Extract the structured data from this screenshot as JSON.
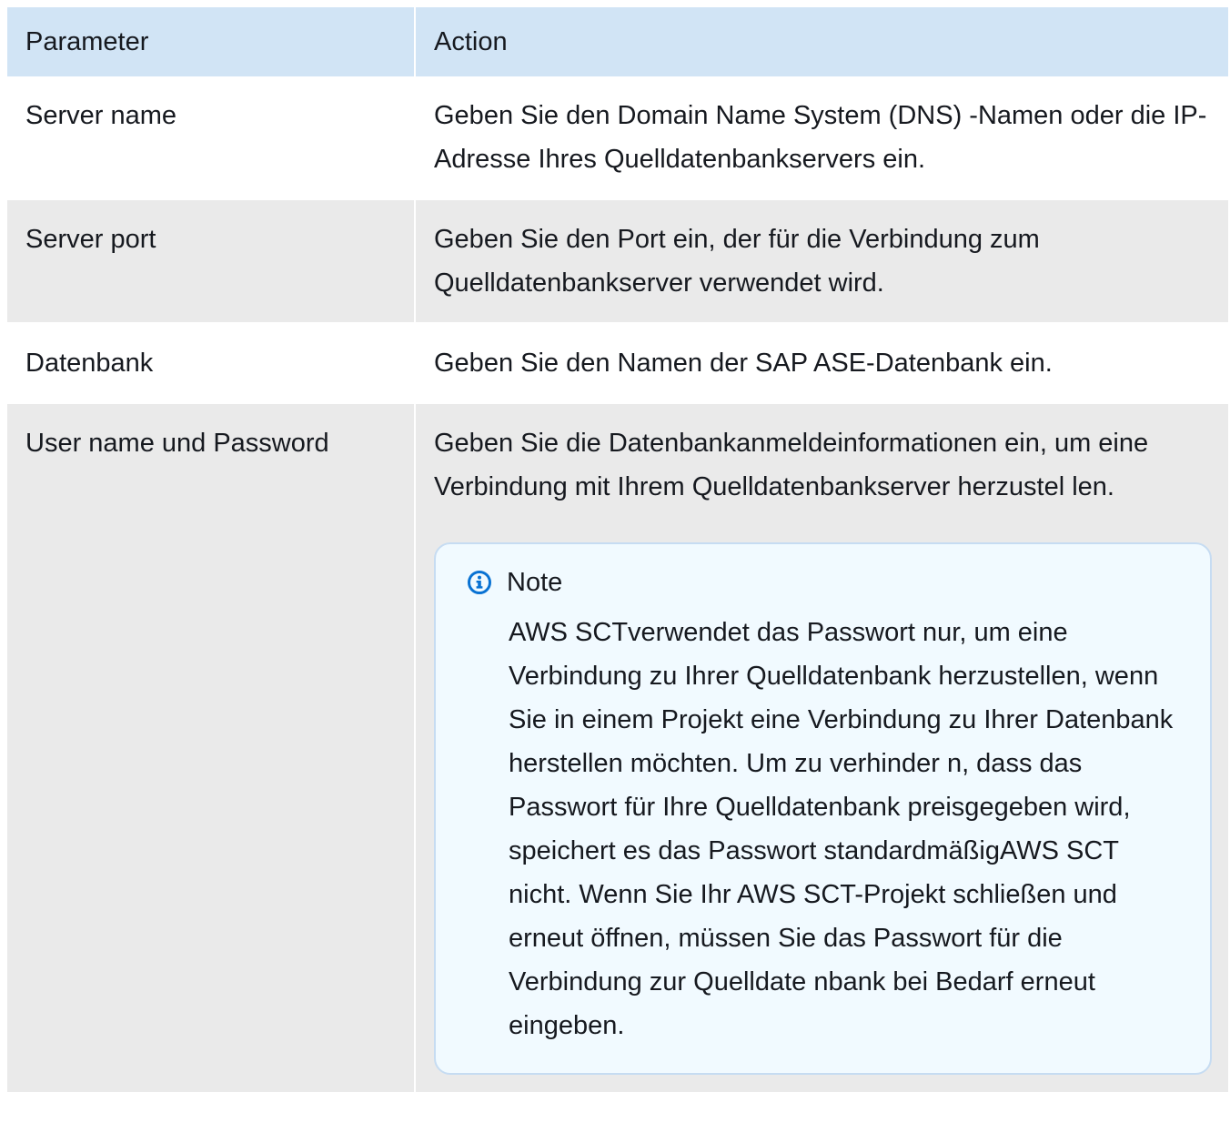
{
  "table": {
    "headers": [
      "Parameter",
      "Action"
    ],
    "rows": [
      {
        "parameter": "Server name",
        "action": "Geben Sie den Domain Name System (DNS) -Namen oder die IP-Adresse Ihres Quelldatenbankservers ein."
      },
      {
        "parameter": "Server port",
        "action": "Geben Sie den Port ein, der für die Verbindung zum Quelldatenbankserver verwendet wird."
      },
      {
        "parameter": "Datenbank",
        "action": "Geben Sie den Namen der SAP ASE-Datenbank ein."
      },
      {
        "parameter": "User name und Password",
        "action": "Geben Sie die Datenbankanmeldeinformationen ein, um eine Verbindung mit Ihrem Quelldatenbankserver herzustel len.",
        "note": {
          "icon": "info-icon",
          "title": "Note",
          "text": "AWS SCTverwendet das Passwort nur, um eine Verbindung zu Ihrer Quelldatenbank herzustellen, wenn Sie in einem Projekt eine Verbindung zu Ihrer Datenbank herstellen möchten. Um zu verhinder n, dass das Passwort für Ihre Quelldatenbank preisgegeben wird, speichert es das Passwort standardmäßigAWS SCT nicht. Wenn Sie Ihr AWS SCT-Projekt schließen und erneut öffnen, müssen Sie das Passwort für die Verbindung zur Quelldate nbank bei Bedarf erneut eingeben."
        }
      }
    ]
  },
  "colors": {
    "header_bg": "#d1e4f5",
    "row_alt_bg": "#eaeaea",
    "note_bg": "#f1faff",
    "note_border": "#c6dcf2",
    "info_icon": "#0972d3"
  }
}
